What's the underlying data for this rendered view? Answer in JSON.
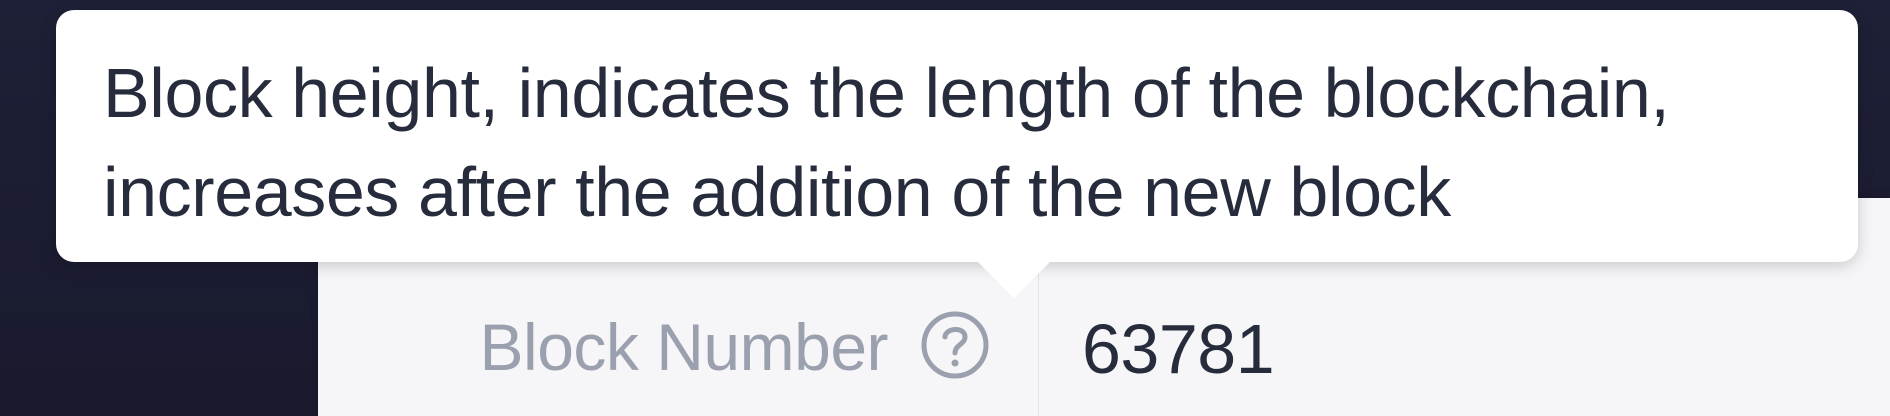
{
  "details": {
    "block_number": {
      "label": "Block Number",
      "value": "63781",
      "help_icon": "question-circle-icon"
    }
  },
  "tooltip": {
    "text": "Block height, indicates the length of the blockchain,\nincreases after the addition of the new block"
  }
}
